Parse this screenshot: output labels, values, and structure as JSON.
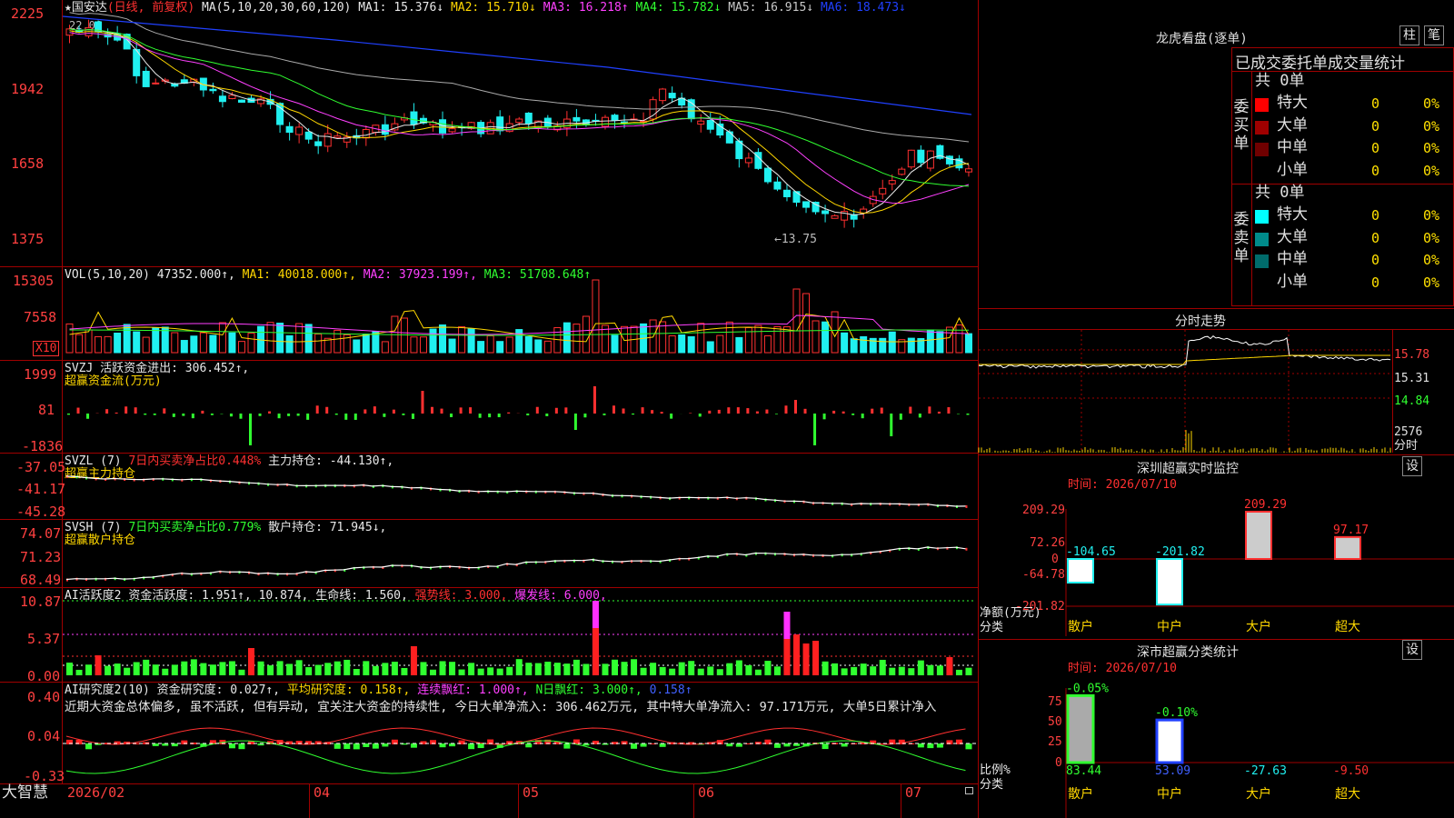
{
  "app": {
    "name": "大智慧"
  },
  "kline": {
    "title_prefix": "★",
    "stock_name": "国安达",
    "period_label": "(日线, 前复权)",
    "ma_header": "MA(5,10,20,30,60,120)",
    "ma": [
      {
        "label": "MA1: 15.376↓",
        "color": "#e8e8e8"
      },
      {
        "label": "MA2: 15.710↓",
        "color": "#ffd700"
      },
      {
        "label": "MA3: 16.218↑",
        "color": "#ff40ff"
      },
      {
        "label": "MA4: 15.782↓",
        "color": "#30ff30"
      },
      {
        "label": "MA5: 16.915↓",
        "color": "#c8c8c8"
      },
      {
        "label": "MA6: 18.473↓",
        "color": "#2040ff"
      }
    ],
    "y_labels": [
      "2225",
      "1942",
      "1658",
      "1375"
    ],
    "high_note": "22.06",
    "low_note": "←13.75"
  },
  "vol": {
    "header": "VOL(5,10,20)",
    "value": "47352.000↑,",
    "ma1": "MA1: 40018.000↑,",
    "ma2": "MA2: 37923.199↑,",
    "ma3": "MA3: 51708.648↑",
    "y_labels": [
      "15305",
      "7558"
    ],
    "unit": "X10"
  },
  "svzj": {
    "header": "SVZJ",
    "text": "活跃资金进出: 306.452↑,",
    "sub": "超赢资金流(万元)",
    "y_labels": [
      "1999",
      "81",
      "-1836"
    ]
  },
  "svzl": {
    "header": "SVZL (7)",
    "ratio": "7日内买卖净占比0.448%",
    "text": "主力持仓: -44.130↑,",
    "sub": "超赢主力持仓",
    "y_labels": [
      "-37.05",
      "-41.17",
      "-45.28"
    ]
  },
  "svsh": {
    "header": "SVSH (7)",
    "ratio": "7日内买卖净占比0.779%",
    "text": "散户持仓: 71.945↓,",
    "sub": "超赢散户持仓",
    "y_labels": [
      "74.07",
      "71.23",
      "68.49"
    ]
  },
  "ai1": {
    "header": "AI活跃度2",
    "t1": "资金活跃度: 1.951↑,",
    "t2": "10.874,",
    "t3": "生命线: 1.560,",
    "t4": "强势线: 3.000,",
    "t5": "爆发线: 6.000,",
    "y_labels": [
      "10.87",
      "5.37",
      "0.00"
    ]
  },
  "ai2": {
    "header": "AI研究度2(10)",
    "t1": "资金研究度: 0.027↑,",
    "t2": "平均研究度: 0.158↑,",
    "t3": "连续飘红: 1.000↑,",
    "t4": "N日飘红: 3.000↑,",
    "t5": "0.158↑",
    "comment": "近期大资金总体偏多, 虽不活跃, 但有异动, 宜关注大资金的持续性, 今日大单净流入: 306.462万元, 其中特大单净流入: 97.171万元, 大单5日累计净入",
    "y_labels": [
      "0.40",
      "0.04",
      "-0.33"
    ]
  },
  "xaxis": {
    "labels": [
      "2026/02",
      "04",
      "05",
      "06",
      "07"
    ]
  },
  "dragon": {
    "title": "龙虎看盘(逐单)",
    "btn1": "柱",
    "btn2": "笔",
    "subtitle": "已成交委托单成交量统计",
    "buy": {
      "side": "委买单",
      "total": "共 0单",
      "rows": [
        {
          "label": "特大",
          "value": "0",
          "pct": "0%",
          "color": "#ff0000"
        },
        {
          "label": "大单",
          "value": "0",
          "pct": "0%",
          "color": "#a00000"
        },
        {
          "label": "中单",
          "value": "0",
          "pct": "0%",
          "color": "#700000"
        },
        {
          "label": "小单",
          "value": "0",
          "pct": "0%",
          "color": "#000000"
        }
      ]
    },
    "sell": {
      "side": "委卖单",
      "total": "共 0单",
      "rows": [
        {
          "label": "特大",
          "value": "0",
          "pct": "0%",
          "color": "#00ffff"
        },
        {
          "label": "大单",
          "value": "0",
          "pct": "0%",
          "color": "#008b8b"
        },
        {
          "label": "中单",
          "value": "0",
          "pct": "0%",
          "color": "#006b6b"
        },
        {
          "label": "小单",
          "value": "0",
          "pct": "0%",
          "color": "#000000"
        }
      ]
    }
  },
  "intraday": {
    "title": "分时走势",
    "y_labels": [
      "15.78",
      "15.31",
      "14.84"
    ],
    "vol_label": "2576",
    "vol_unit": "分时"
  },
  "monitor": {
    "title": "深圳超赢实时监控",
    "btn": "设",
    "time": "时间: 2026/07/10",
    "y_labels": [
      "209.29",
      "72.26",
      "0",
      "-64.78",
      "-201.82"
    ],
    "axis_name": "净额(万元)",
    "axis_cat": "分类",
    "categories": [
      "散户",
      "中户",
      "大户",
      "超大"
    ],
    "chart_data": {
      "type": "bar",
      "categories": [
        "散户",
        "中户",
        "大户",
        "超大"
      ],
      "values": [
        -104.65,
        -201.82,
        209.29,
        97.17
      ],
      "ylim": [
        -201.82,
        209.29
      ]
    }
  },
  "classify": {
    "title": "深市超赢分类统计",
    "btn": "设",
    "time": "时间: 2026/07/10",
    "y_labels": [
      "75",
      "50",
      "25",
      "0"
    ],
    "axis_name": "比例%",
    "axis_cat": "分类",
    "categories": [
      "散户",
      "中户",
      "大户",
      "超大"
    ],
    "chart_data": {
      "type": "bar",
      "categories": [
        "散户",
        "中户",
        "大户",
        "超大"
      ],
      "top_labels": [
        "-0.05%",
        "-0.10%",
        "",
        ""
      ],
      "values": [
        83.44,
        53.09,
        -27.63,
        -9.5
      ],
      "ylim": [
        0,
        85
      ]
    }
  }
}
